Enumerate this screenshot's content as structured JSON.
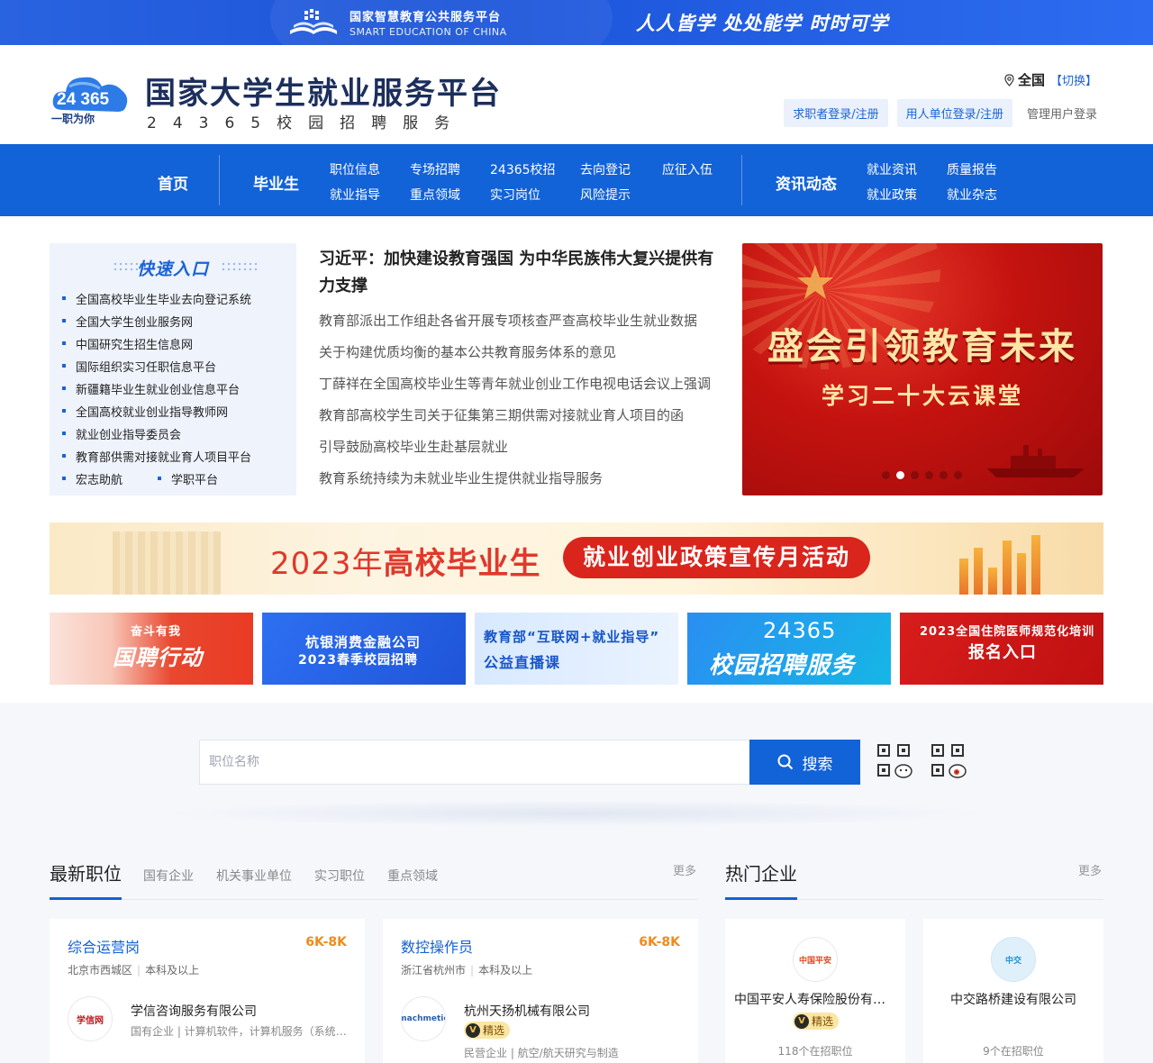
{
  "topbar": {
    "platform_cn": "国家智慧教育公共服务平台",
    "platform_en": "SMART EDUCATION OF CHINA",
    "slogan": "人人皆学 处处能学 时时可学"
  },
  "header": {
    "logo_num": "24 365",
    "logo_slogan": "一职为你",
    "title": "国家大学生就业服务平台",
    "subtitle": "24365校园招聘服务",
    "location": "全国",
    "switch": "【切换】",
    "login_seeker": "求职者登录/注册",
    "login_employer": "用人单位登录/注册",
    "login_admin": "管理用户登录"
  },
  "nav": {
    "home": "首页",
    "graduate": "毕业生",
    "news": "资讯动态",
    "grad_links": [
      "职位信息",
      "专场招聘",
      "24365校招",
      "去向登记",
      "应征入伍",
      "就业指导",
      "重点领域",
      "实习岗位",
      "风险提示"
    ],
    "news_links": [
      "就业资讯",
      "质量报告",
      "就业政策",
      "就业杂志"
    ]
  },
  "quick": {
    "title": "快速入口",
    "items": [
      "全国高校毕业生毕业去向登记系统",
      "全国大学生创业服务网",
      "中国研究生招生信息网",
      "国际组织实习任职信息平台",
      "新疆籍毕业生就业创业信息平台",
      "全国高校就业创业指导教师网",
      "就业创业指导委员会",
      "教育部供需对接就业育人项目平台"
    ],
    "last": [
      "宏志助航",
      "学职平台"
    ]
  },
  "news": {
    "headline": "习近平：加快建设教育强国 为中华民族伟大复兴提供有力支撑",
    "items": [
      "教育部派出工作组赴各省开展专项核查严查高校毕业生就业数据",
      "关于构建优质均衡的基本公共教育服务体系的意见",
      "丁薛祥在全国高校毕业生等青年就业创业工作电视电话会议上强调",
      "教育部高校学生司关于征集第三期供需对接就业育人项目的函",
      "引导鼓励高校毕业生赴基层就业",
      "教育系统持续为未就业毕业生提供就业指导服务"
    ]
  },
  "banner": {
    "line1": "盛会引领教育未来",
    "line2": "学习二十大云课堂",
    "slides": 6,
    "active_slide": 2
  },
  "policy": {
    "year": "2023年",
    "who": "高校毕业生",
    "pill": "就业创业政策宣传月活动"
  },
  "ads": {
    "a1": "国聘行动",
    "a1_top": "奋斗有我",
    "a2_l1": "杭银消费金融公司",
    "a2_l2": "2023春季校园招聘",
    "a3_l1": "教育部“互联网+就业指导”",
    "a3_l2": "公益直播课",
    "a4_l1": "24365",
    "a4_l2": "校园招聘服务",
    "a5_l1": "2023全国住院医师规范化培训",
    "a5_l2": "报名入口"
  },
  "search": {
    "placeholder": "职位名称",
    "button": "搜索"
  },
  "jobs": {
    "title": "最新职位",
    "tabs": [
      "国有企业",
      "机关事业单位",
      "实习职位",
      "重点领域"
    ],
    "more": "更多",
    "cards": [
      {
        "title": "综合运营岗",
        "salary": "6K-8K",
        "city": "北京市西城区",
        "edu": "本科及以上",
        "company": "学信咨询服务有限公司",
        "logo": "学信网",
        "info": "国有企业 | 计算机软件，计算机服务（系统、数据服务、维修）"
      },
      {
        "title": "数控操作员",
        "salary": "6K-8K",
        "city": "浙江省杭州市",
        "edu": "本科及以上",
        "company": "杭州天扬机械有限公司",
        "logo": "machmetic",
        "badge": "精选",
        "info": "民营企业 | 航空/航天研究与制造"
      }
    ]
  },
  "enterprises": {
    "title": "热门企业",
    "more": "更多",
    "cards": [
      {
        "name": "中国平安人寿保险股份有限公司",
        "logo": "中国平安",
        "badge": "精选",
        "count": "118个在招职位"
      },
      {
        "name": "中交路桥建设有限公司",
        "logo": "中交",
        "count": "9个在招职位"
      }
    ]
  },
  "colors": {
    "primary": "#1262d8",
    "accent": "#f08a1c",
    "red": "#d9251c"
  }
}
